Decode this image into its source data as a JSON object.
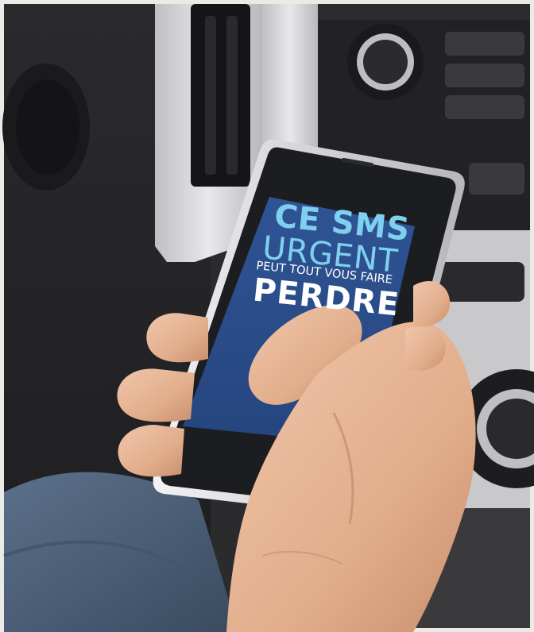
{
  "screen_message": {
    "line1": "CE SMS",
    "line2": "URGENT",
    "line3": "PEUT TOUT VOUS FAIRE",
    "line4": "PERDRE"
  },
  "colors": {
    "screen_blue": "#2d4f8f",
    "accent_cyan": "#7fd0ee",
    "text_white": "#ffffff",
    "phone_body": "#1e1f22",
    "phone_bezel": "#dcdde0",
    "skin": "#e7b799",
    "jeans": "#4d6278",
    "dashboard_gray": "#c9c9c9"
  }
}
